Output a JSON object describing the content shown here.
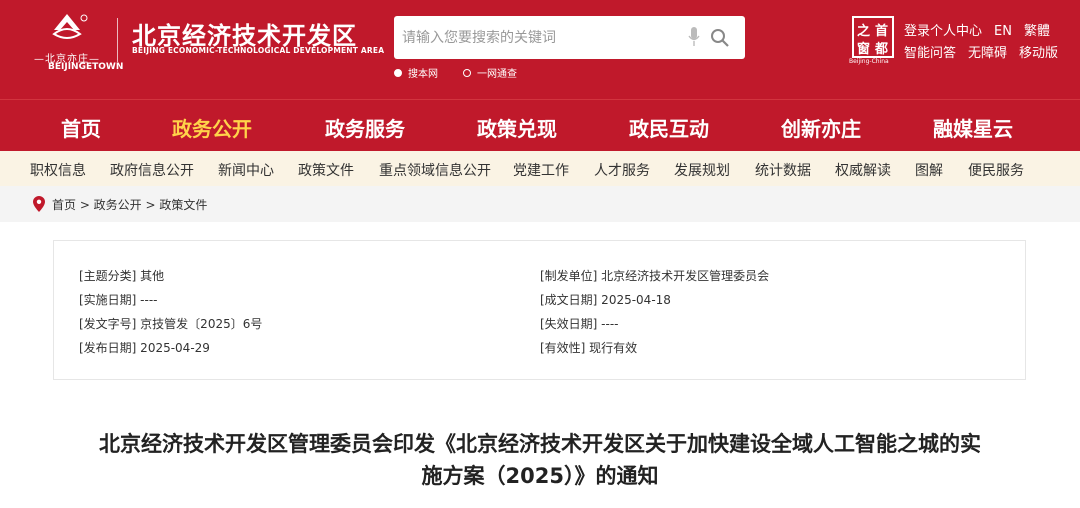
{
  "header": {
    "logo_cn_small": "—北京亦庄—",
    "logo_en_small": "BEIJINGETOWN",
    "site_title": "北京经济技术开发区",
    "site_subtitle": "BEIJING ECONOMIC-TECHNOLOGICAL DEVELOPMENT AREA",
    "search_placeholder": "请输入您要搜索的关键词",
    "scope_site": "搜本网",
    "scope_all": "一网通查",
    "capital_logo_chars": [
      "之",
      "首",
      "窗",
      "都"
    ],
    "capital_logo_en": "Beijing-China",
    "links_row1": [
      "登录",
      "个人中心",
      "EN",
      "繁體"
    ],
    "links_row2": [
      "智能问答",
      "无障碍",
      "移动版"
    ],
    "icons": [
      "logo-mark-icon",
      "mic-icon",
      "search-icon",
      "location-pin-icon"
    ],
    "colors": {
      "brand_red": "#c0192b",
      "active_nav": "#ffd34a",
      "subnav_bg": "#faf3e4"
    }
  },
  "main_nav": {
    "items": [
      "首页",
      "政务公开",
      "政务服务",
      "政策兑现",
      "政民互动",
      "创新亦庄",
      "融媒星云"
    ],
    "active": "政务公开"
  },
  "sub_nav": {
    "items": [
      "职权信息",
      "政府信息公开",
      "新闻中心",
      "政策文件",
      "重点领域信息公开",
      "党建工作",
      "人才服务",
      "发展规划",
      "统计数据",
      "权威解读",
      "图解",
      "便民服务"
    ]
  },
  "breadcrumb": {
    "text": "首页 > 政务公开 > 政策文件"
  },
  "meta": {
    "topic": "[主题分类] 其他",
    "impl_date": "[实施日期] ----",
    "doc_no": "[发文字号] 京技管发〔2025〕6号",
    "pub_date": "[发布日期] 2025-04-29",
    "issuer": "[制发单位] 北京经济技术开发区管理委员会",
    "written_date": "[成文日期] 2025-04-18",
    "expiry_date": "[失效日期] ----",
    "validity": "[有效性] 现行有效"
  },
  "article": {
    "title_line1": "北京经济技术开发区管理委员会印发《北京经济技术开发区关于加快建设全域人工智能之城的实",
    "title_line2": "施方案（2025）》的通知"
  }
}
